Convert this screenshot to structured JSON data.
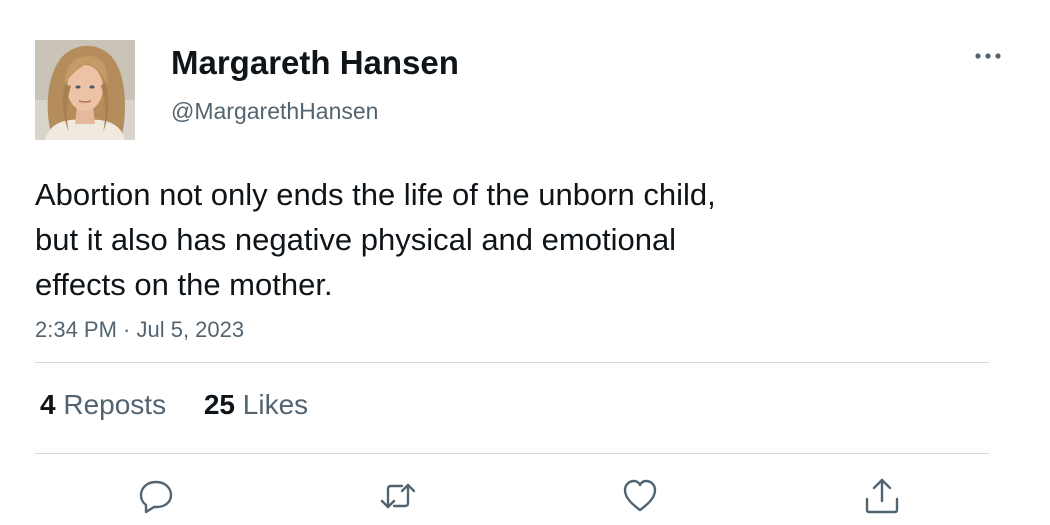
{
  "author": {
    "display_name": "Margareth Hansen",
    "handle": "@MargarethHansen",
    "avatar_icon": "profile-photo"
  },
  "tweet": {
    "text_lines": [
      "Abortion not only ends the life of the unborn child,",
      "but it also has negative physical and emotional",
      "effects on the mother."
    ],
    "timestamp": "2:34 PM · Jul 5, 2023"
  },
  "stats": {
    "reposts_count": "4",
    "reposts_label": "Reposts",
    "likes_count": "25",
    "likes_label": "Likes"
  },
  "actions": {
    "icons": [
      "reply-icon",
      "repost-icon",
      "like-icon",
      "share-icon"
    ]
  },
  "colors": {
    "text_primary": "#0f1419",
    "text_secondary": "#536471",
    "divider": "#cfd9de",
    "background": "#ffffff"
  }
}
